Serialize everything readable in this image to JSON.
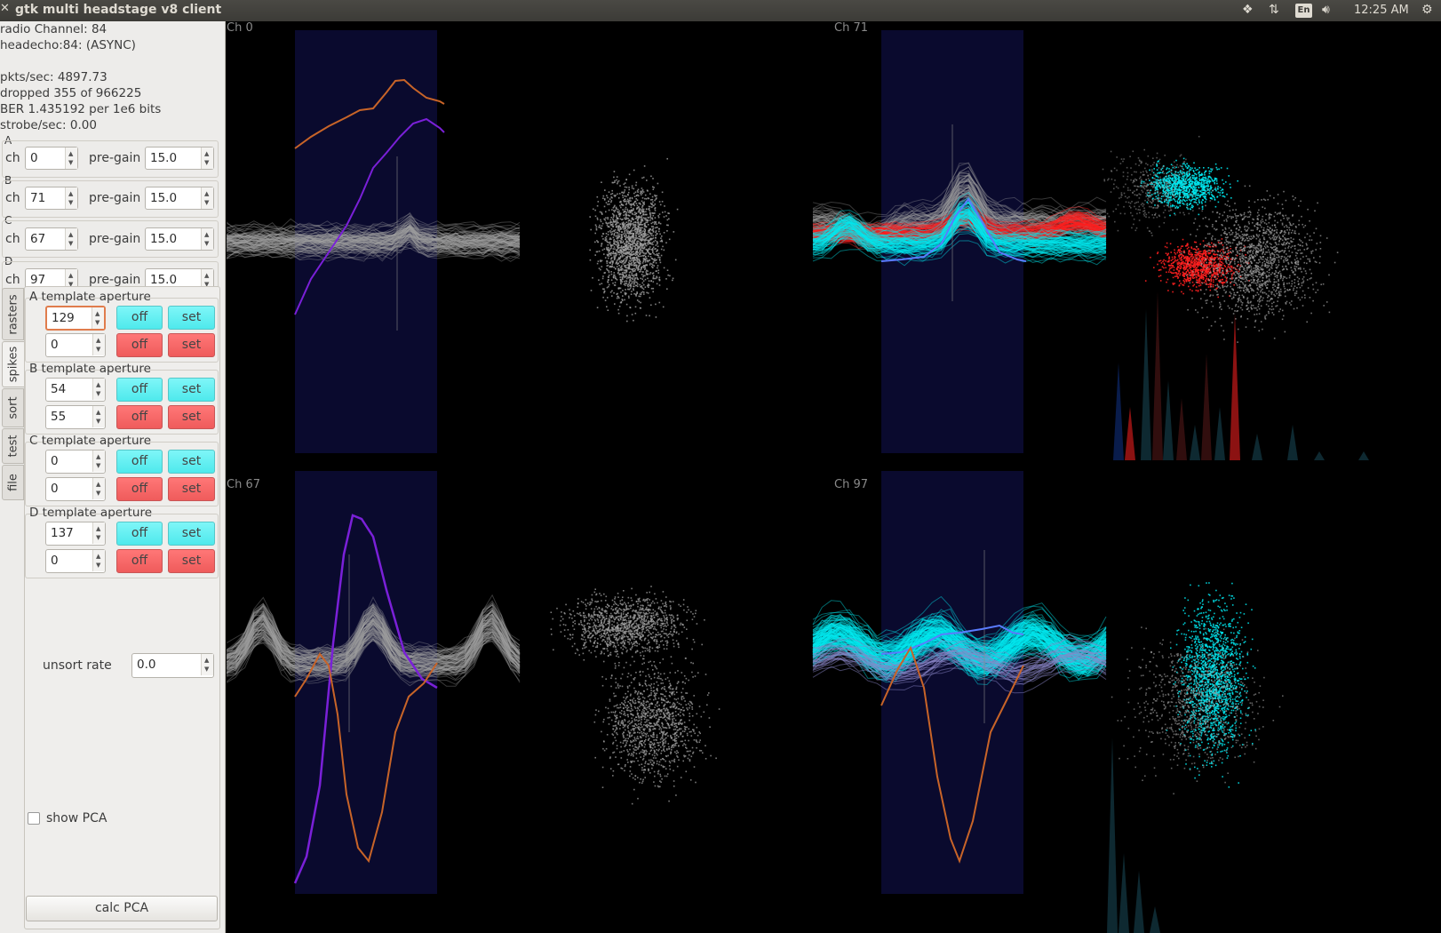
{
  "window": {
    "title": "gtk multi headstage v8 client",
    "clock": "12:25 AM",
    "keyboard_layout": "En"
  },
  "status": {
    "radio_channel": "radio Channel: 84",
    "headecho": "headecho:84: (ASYNC)",
    "pkts_sec": "pkts/sec: 4897.73",
    "dropped": "dropped 355 of 966225",
    "ber": "BER 1.435192 per 1e6 bits",
    "strobe": "strobe/sec: 0.00"
  },
  "channels": [
    {
      "letter": "A",
      "ch_label": "ch",
      "ch": "0",
      "pregain_label": "pre-gain",
      "pregain": "15.0"
    },
    {
      "letter": "B",
      "ch_label": "ch",
      "ch": "71",
      "pregain_label": "pre-gain",
      "pregain": "15.0"
    },
    {
      "letter": "C",
      "ch_label": "ch",
      "ch": "67",
      "pregain_label": "pre-gain",
      "pregain": "15.0"
    },
    {
      "letter": "D",
      "ch_label": "ch",
      "ch": "97",
      "pregain_label": "pre-gain",
      "pregain": "15.0"
    }
  ],
  "tabs": [
    "rasters",
    "spikes",
    "sort",
    "test",
    "file"
  ],
  "active_tab": "spikes",
  "templates": [
    {
      "title": "A template aperture",
      "rows": [
        {
          "value": "129",
          "off": "off",
          "set": "set",
          "color": "cyan"
        },
        {
          "value": "0",
          "off": "off",
          "set": "set",
          "color": "red"
        }
      ]
    },
    {
      "title": "B template aperture",
      "rows": [
        {
          "value": "54",
          "off": "off",
          "set": "set",
          "color": "cyan"
        },
        {
          "value": "55",
          "off": "off",
          "set": "set",
          "color": "red"
        }
      ]
    },
    {
      "title": "C template aperture",
      "rows": [
        {
          "value": "0",
          "off": "off",
          "set": "set",
          "color": "cyan"
        },
        {
          "value": "0",
          "off": "off",
          "set": "set",
          "color": "red"
        }
      ]
    },
    {
      "title": "D template aperture",
      "rows": [
        {
          "value": "137",
          "off": "off",
          "set": "set",
          "color": "cyan"
        },
        {
          "value": "0",
          "off": "off",
          "set": "set",
          "color": "red"
        }
      ]
    }
  ],
  "unsort_rate": {
    "label": "unsort rate",
    "value": "0.0"
  },
  "show_pca": {
    "label": "show PCA",
    "checked": false
  },
  "calc_pca": {
    "label": "calc PCA"
  },
  "plots": [
    {
      "label": "Ch 0"
    },
    {
      "label": "Ch 71"
    },
    {
      "label": "Ch 67"
    },
    {
      "label": "Ch 97"
    }
  ],
  "colors": {
    "aperture": "#0a0a2e",
    "unsorted": "#a0a0a0",
    "unit_a": "#00e8f0",
    "unit_b": "#ff2020",
    "template_orange": "#c86428",
    "template_purple": "#7a20d8"
  }
}
